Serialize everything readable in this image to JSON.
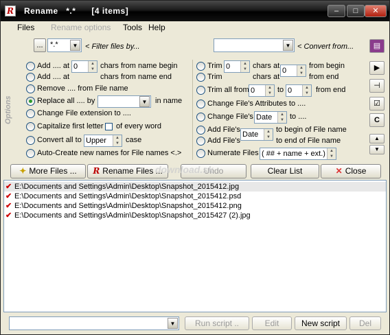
{
  "window": {
    "title": "Rename   *.*      [4 items]",
    "app_icon": "rename-app-icon",
    "controls": {
      "minimize": "–",
      "maximize": "□",
      "close": "✕"
    }
  },
  "menu": {
    "files": "Files",
    "rename_options": "Rename options",
    "tools": "Tools",
    "help": "Help"
  },
  "filter": {
    "dots_button": "...",
    "mask_value": "*.*",
    "filter_label": "< Filter files by...",
    "convert_value": "",
    "convert_label": "< Convert from..."
  },
  "side_label": "Options",
  "left_options": {
    "add_begin": {
      "label": "Add .... at",
      "value": "0",
      "suffix": "chars from name begin"
    },
    "add_end": {
      "label": "Add .... at",
      "value": "0",
      "suffix": "chars from name end"
    },
    "remove": "Remove .... from File name",
    "replace": {
      "label": "Replace all .... by",
      "value": "",
      "suffix": "in name",
      "selected": true
    },
    "change_ext": "Change File extension to ....",
    "capitalize": {
      "label": "Capitalize first letter",
      "check_label": "of every word"
    },
    "convert": {
      "label": "Convert all to",
      "value": "Upper",
      "suffix": "case"
    },
    "auto_create": "Auto-Create new names for File names <.>"
  },
  "right_options": {
    "trim_begin": {
      "label": "Trim",
      "value": "0",
      "mid": "chars at",
      "suffix": "from begin"
    },
    "trim_end": {
      "label": "Trim",
      "value": "0",
      "mid": "chars at",
      "value2": "0",
      "suffix": "from  end"
    },
    "trim_all": {
      "label": "Trim all from",
      "from": "0",
      "to_label": "to",
      "to": "0",
      "suffix": "from end"
    },
    "change_attrs": "Change File's Attributes to ....",
    "change_files": {
      "label": "Change File's",
      "value": "Date",
      "suffix": "to ...."
    },
    "add_begin": {
      "label": "Add File's",
      "value": "Date",
      "suffix": "to begin of File name"
    },
    "add_end": {
      "label": "Add File's",
      "suffix": "to end of File name"
    },
    "numerate": {
      "label": "Numerate Files",
      "value": "( ## + name + ext.)"
    }
  },
  "right_toolbar": [
    "book-icon",
    "play-icon",
    "pin-icon",
    "check-icon",
    "c-icon",
    "up-icon",
    "down-icon"
  ],
  "actions": {
    "more_files": "More Files ...",
    "rename_files": "Rename Files ...",
    "undo": "Undo",
    "clear_list": "Clear List",
    "close": "Close"
  },
  "watermark": "download.sk",
  "files": [
    "E:\\Documents and Settings\\Admin\\Desktop\\Snapshot_2015412.jpg",
    "E:\\Documents and Settings\\Admin\\Desktop\\Snapshot_2015412.psd",
    "E:\\Documents and Settings\\Admin\\Desktop\\Snapshot_2015412.png",
    "E:\\Documents and Settings\\Admin\\Desktop\\Snapshot_2015427 (2).jpg"
  ],
  "bottom": {
    "script_value": "",
    "run_script": "Run script ..",
    "edit": "Edit",
    "new_script": "New script",
    "del": "Del"
  }
}
